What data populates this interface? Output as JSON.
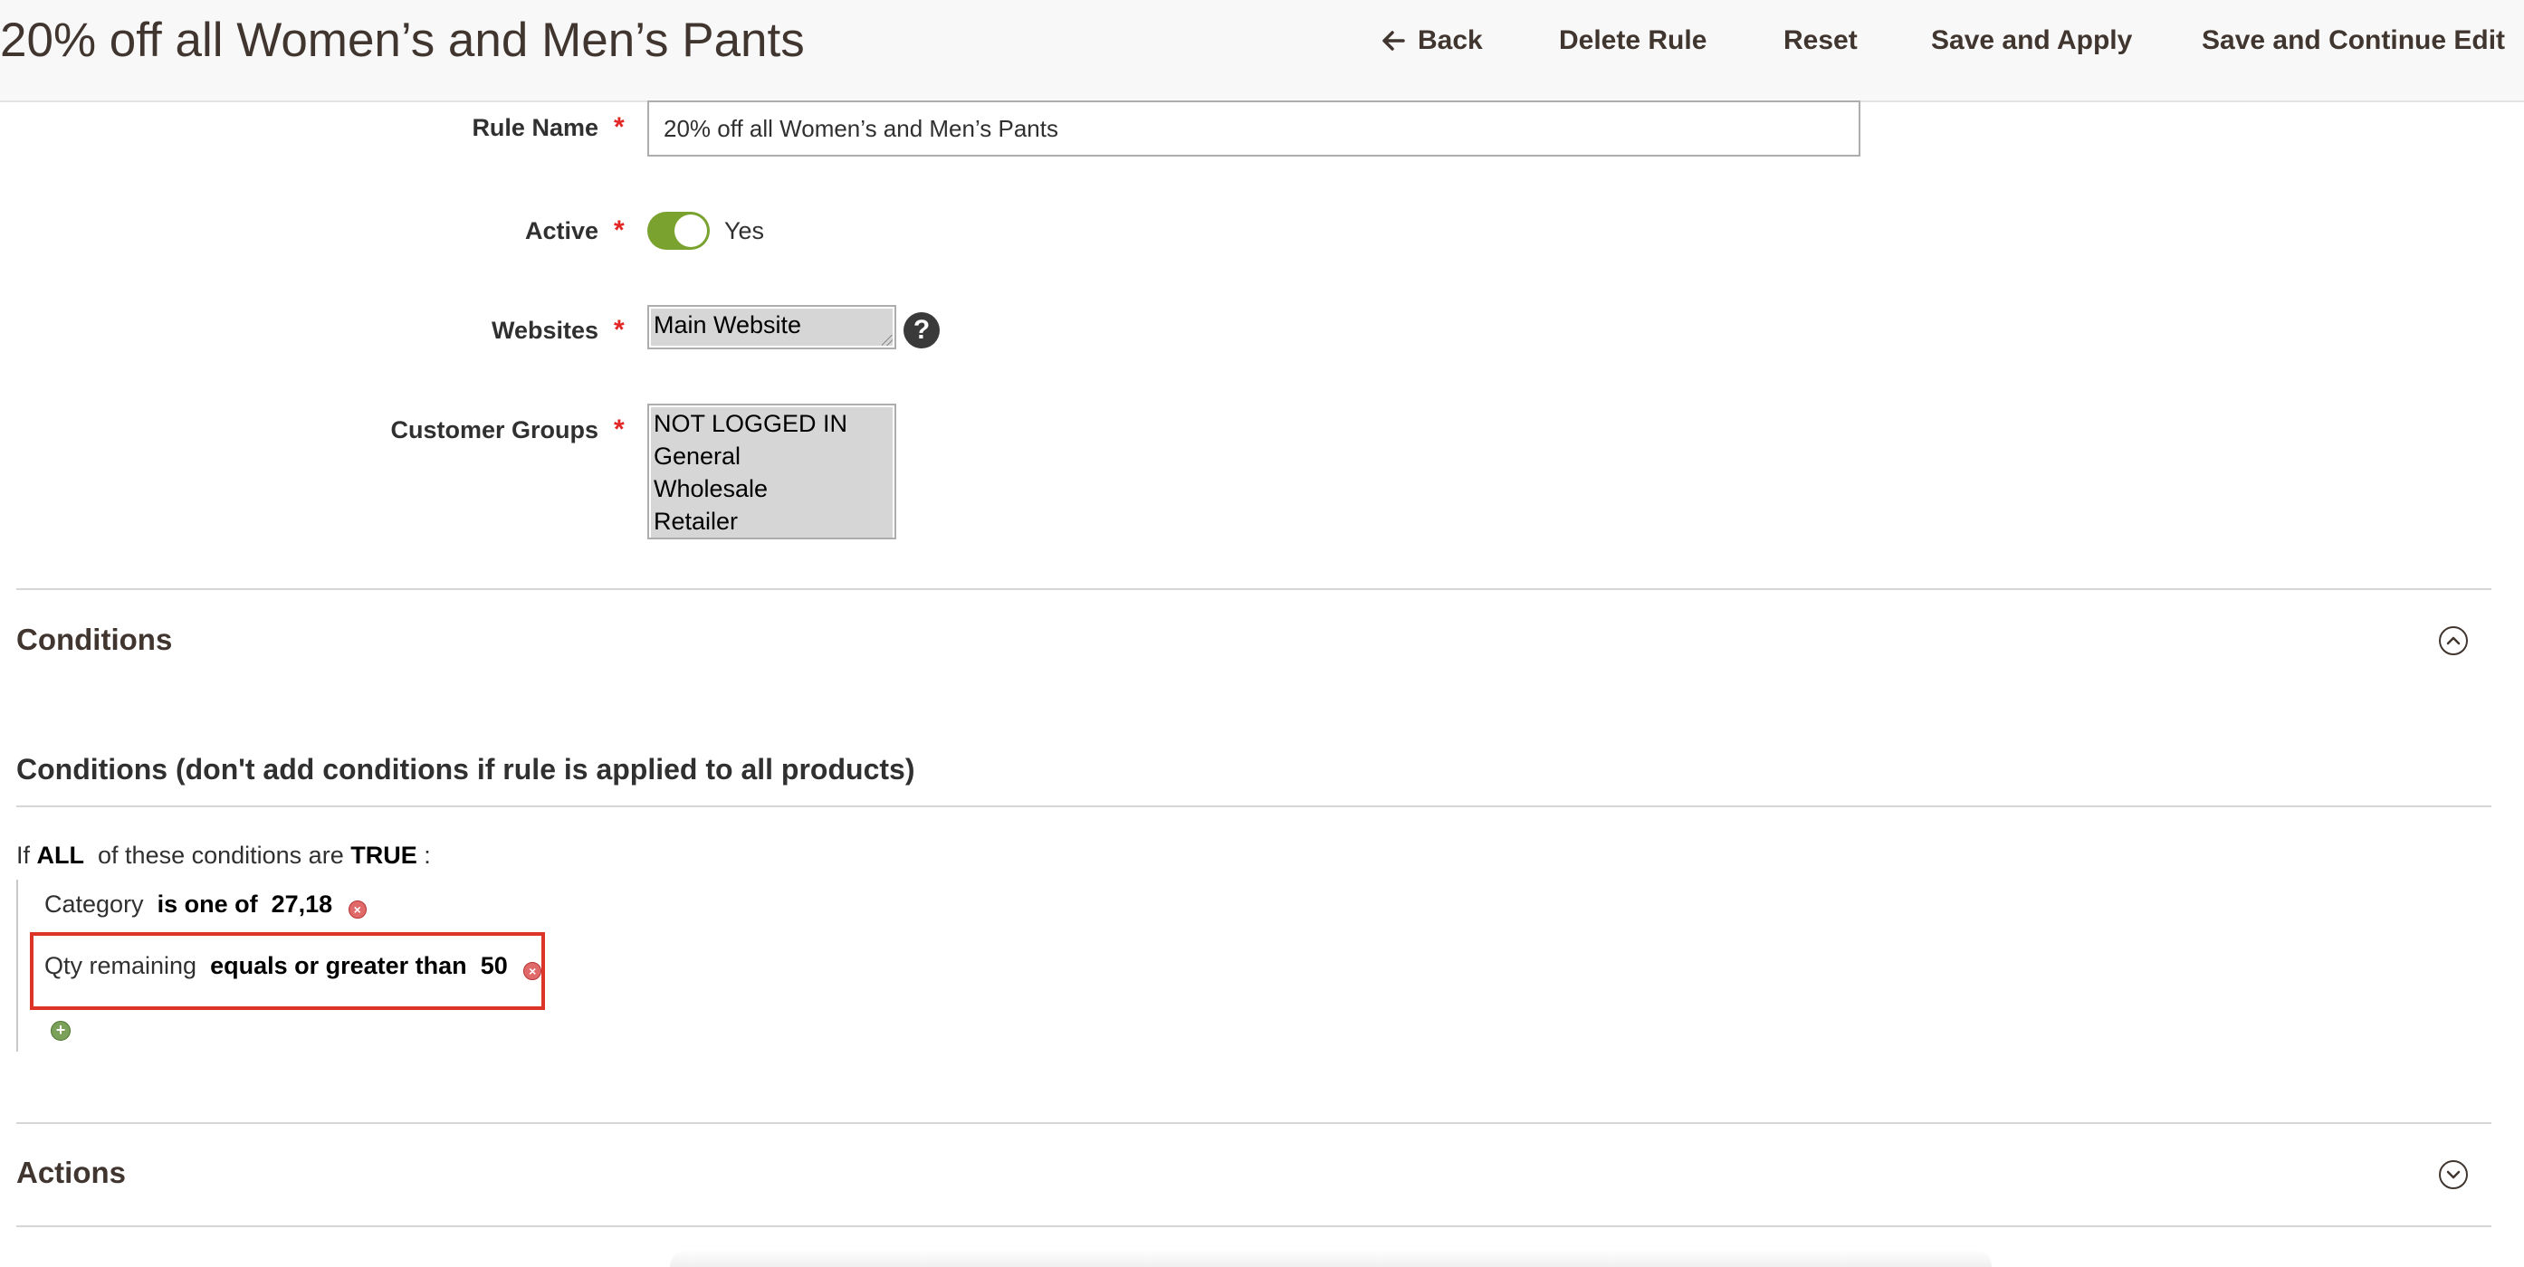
{
  "header": {
    "title": "20% off all Women’s and Men’s Pants",
    "back_label": "Back",
    "delete_label": "Delete Rule",
    "reset_label": "Reset",
    "save_apply_label": "Save and Apply",
    "save_continue_label": "Save and Continue Edit"
  },
  "form": {
    "rule_name": {
      "label": "Rule Name",
      "value": "20% off all Women’s and Men’s Pants"
    },
    "active": {
      "label": "Active",
      "state_label": "Yes",
      "on": true
    },
    "websites": {
      "label": "Websites",
      "options": [
        "Main Website"
      ]
    },
    "customer_groups": {
      "label": "Customer Groups",
      "options": [
        "NOT LOGGED IN",
        "General",
        "Wholesale",
        "Retailer"
      ]
    }
  },
  "conditions": {
    "section_title": "Conditions",
    "legend": "Conditions (don't add conditions if rule is applied to all products)",
    "intro": {
      "prefix": "If",
      "aggregator": "ALL",
      "middle": "of these conditions are",
      "value": "TRUE",
      "suffix": ":"
    },
    "rows": [
      {
        "attribute": "Category",
        "operator": "is one of",
        "value": "27,18"
      },
      {
        "attribute": "Qty remaining",
        "operator": "equals or greater than",
        "value": "50"
      }
    ]
  },
  "actions": {
    "section_title": "Actions"
  },
  "colors": {
    "accent_toggle": "#79a22e",
    "required": "#e22626",
    "highlight": "#dc3427"
  }
}
